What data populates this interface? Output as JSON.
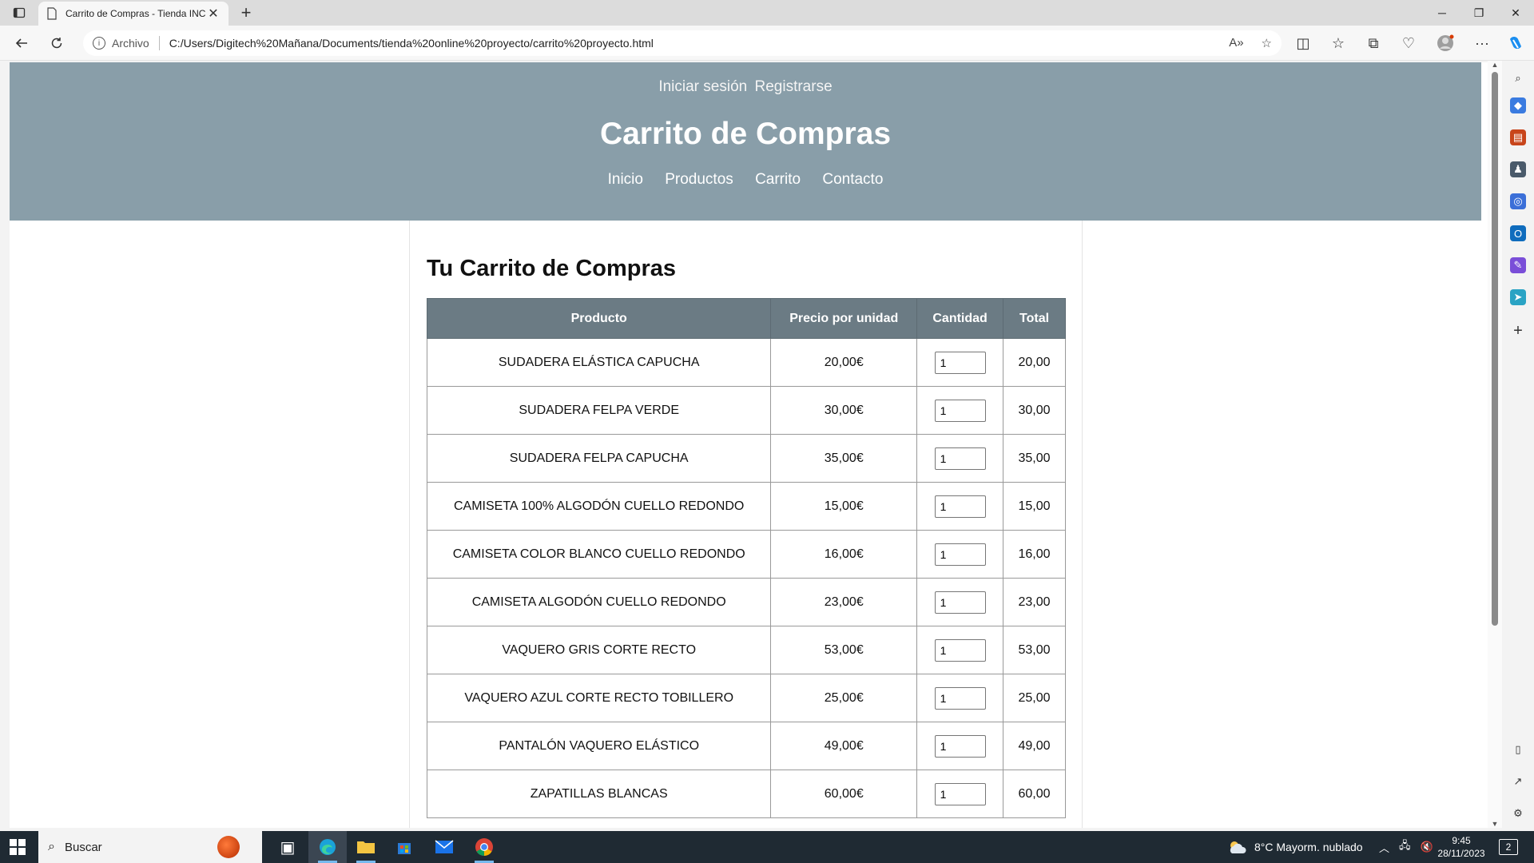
{
  "browser": {
    "tab_title": "Carrito de Compras - Tienda INC",
    "address_scheme": "Archivo",
    "url": "C:/Users/Digitech%20Mañana/Documents/tienda%20online%20proyecto/carrito%20proyecto.html"
  },
  "header": {
    "login": "Iniciar sesión",
    "register": "Registrarse",
    "title": "Carrito de Compras",
    "nav": [
      "Inicio",
      "Productos",
      "Carrito",
      "Contacto"
    ]
  },
  "cart": {
    "heading": "Tu Carrito de Compras",
    "columns": [
      "Producto",
      "Precio por unidad",
      "Cantidad",
      "Total"
    ],
    "rows": [
      {
        "product": "SUDADERA ELÁSTICA CAPUCHA",
        "price": "20,00€",
        "qty": "1",
        "total": "20,00"
      },
      {
        "product": "SUDADERA FELPA VERDE",
        "price": "30,00€",
        "qty": "1",
        "total": "30,00"
      },
      {
        "product": "SUDADERA FELPA CAPUCHA",
        "price": "35,00€",
        "qty": "1",
        "total": "35,00"
      },
      {
        "product": "CAMISETA 100% ALGODÓN CUELLO REDONDO",
        "price": "15,00€",
        "qty": "1",
        "total": "15,00"
      },
      {
        "product": "CAMISETA COLOR BLANCO CUELLO REDONDO",
        "price": "16,00€",
        "qty": "1",
        "total": "16,00"
      },
      {
        "product": "CAMISETA ALGODÓN CUELLO REDONDO",
        "price": "23,00€",
        "qty": "1",
        "total": "23,00"
      },
      {
        "product": "VAQUERO GRIS CORTE RECTO",
        "price": "53,00€",
        "qty": "1",
        "total": "53,00"
      },
      {
        "product": "VAQUERO AZUL CORTE RECTO TOBILLERO",
        "price": "25,00€",
        "qty": "1",
        "total": "25,00"
      },
      {
        "product": "PANTALÓN VAQUERO ELÁSTICO",
        "price": "49,00€",
        "qty": "1",
        "total": "49,00"
      },
      {
        "product": "ZAPATILLAS BLANCAS",
        "price": "60,00€",
        "qty": "1",
        "total": "60,00"
      }
    ]
  },
  "taskbar": {
    "search_label": "Buscar",
    "weather": "8°C  Mayorm. nublado",
    "time": "9:45",
    "date": "28/11/2023",
    "notifications": "2"
  },
  "colors": {
    "header_bg": "#899ea9",
    "table_header_bg": "#6b7b84",
    "taskbar_bg": "#1f2a33"
  }
}
